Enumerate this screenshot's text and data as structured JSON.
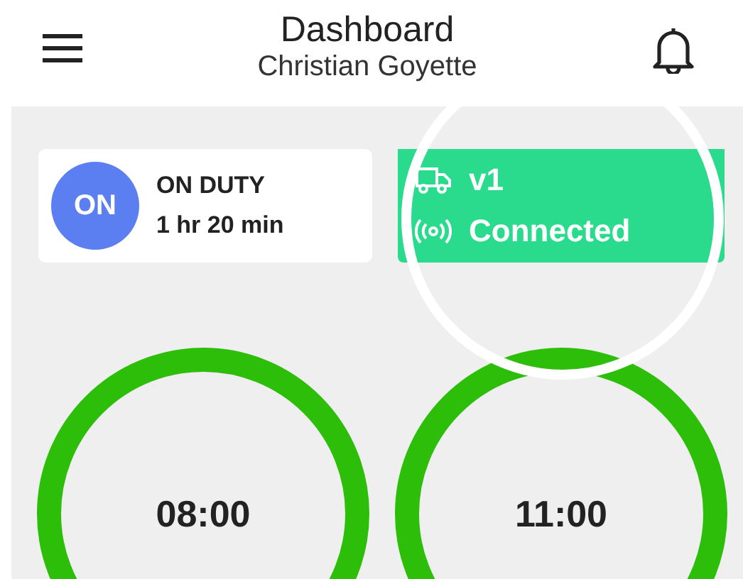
{
  "header": {
    "title": "Dashboard",
    "subtitle": "Christian Goyette"
  },
  "duty_card": {
    "badge": "ON",
    "status": "ON DUTY",
    "duration": "1 hr 20 min"
  },
  "vehicle_card": {
    "vehicle": "v1",
    "connection": "Connected"
  },
  "timers": [
    {
      "time": "08:00",
      "color": "#2dbe0a"
    },
    {
      "time": "11:00",
      "color": "#2dbe0a"
    }
  ]
}
